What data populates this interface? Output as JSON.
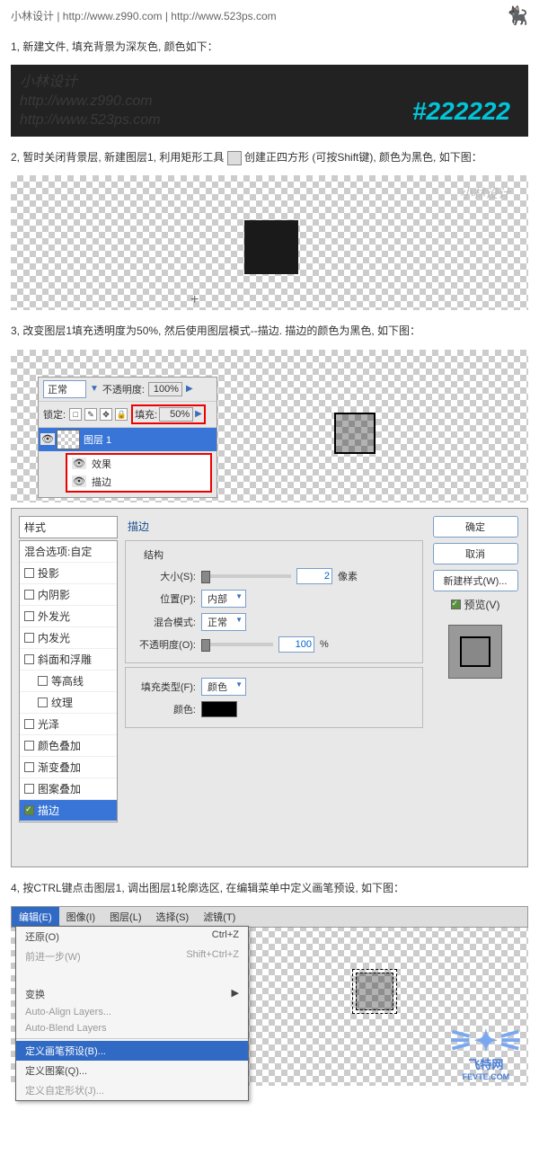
{
  "header": {
    "credit": "小林设计 | http://www.z990.com | http://www.523ps.com"
  },
  "step1": {
    "text": "1, 新建文件, 填充背景为深灰色, 颜色如下：",
    "color_code": "#222222",
    "wm": "小林设计\nhttp://www.z990.com\nhttp://www.523ps.com"
  },
  "step2": {
    "text": "2, 暂时关闭背景层, 新建图层1, 利用矩形工具",
    "text2": " 创建正四方形 (可按Shift键), 颜色为黑色, 如下图："
  },
  "step3": {
    "text": "3, 改变图层1填充透明度为50%, 然后使用图层模式--描边. 描边的颜色为黑色, 如下图：",
    "blend_label": "正常",
    "opacity_label": "不透明度:",
    "opacity_val": "100%",
    "lock_label": "锁定:",
    "fill_label": "填充:",
    "fill_val": "50%",
    "layer_name": "图层 1",
    "fx_label": "效果",
    "stroke_label": "描边"
  },
  "dialog": {
    "styles_head": "样式",
    "blend_opts": "混合选项:自定",
    "items": [
      "投影",
      "内阴影",
      "外发光",
      "内发光",
      "斜面和浮雕",
      "等高线",
      "纹理",
      "光泽",
      "颜色叠加",
      "渐变叠加",
      "图案叠加",
      "描边"
    ],
    "stroke_title": "描边",
    "struct_label": "结构",
    "size_label": "大小(S):",
    "size_val": "2",
    "px": "像素",
    "pos_label": "位置(P):",
    "pos_val": "内部",
    "blend_label": "混合模式:",
    "blend_val": "正常",
    "opac_label": "不透明度(O):",
    "opac_val": "100",
    "pct": "%",
    "filltype_label": "填充类型(F):",
    "filltype_val": "颜色",
    "color_label": "颜色:",
    "ok": "确定",
    "cancel": "取消",
    "newstyle": "新建样式(W)...",
    "preview": "预览(V)"
  },
  "step4": {
    "text": "4, 按CTRL键点击图层1, 调出图层1轮廓选区, 在编辑菜单中定义画笔预设, 如下图：",
    "menus": [
      "编辑(E)",
      "图像(I)",
      "图层(L)",
      "选择(S)",
      "滤镜(T)"
    ],
    "undo": "还原(O)",
    "undo_key": "Ctrl+Z",
    "redo": "前进一步(W)",
    "redo_key": "Shift+Ctrl+Z",
    "transform": "变换",
    "align": "Auto-Align Layers...",
    "blend": "Auto-Blend Layers",
    "define_brush": "定义画笔预设(B)...",
    "define_pattern": "定义图案(Q)...",
    "define_shape": "定义自定形状(J)..."
  },
  "logo": {
    "name": "飞特网",
    "url": "FEVTE.COM"
  }
}
